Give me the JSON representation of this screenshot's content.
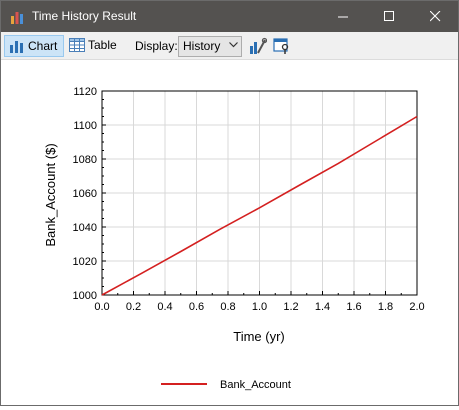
{
  "window": {
    "title": "Time History Result",
    "minimize_icon": "minimize-icon",
    "maximize_icon": "maximize-icon",
    "close_icon": "close-icon"
  },
  "toolbar": {
    "chart_label": "Chart",
    "table_label": "Table",
    "display_label": "Display:",
    "display_value": "History",
    "active_view": "Chart"
  },
  "colors": {
    "series": "#d42020",
    "grid": "#d9d9d9",
    "active_button_bg": "#cce4f7",
    "titlebar": "#545250"
  },
  "chart_data": {
    "type": "line",
    "xlabel": "Time (yr)",
    "ylabel": "Bank_Account ($)",
    "xlim": [
      0,
      2
    ],
    "ylim": [
      1000,
      1120
    ],
    "xticks": [
      "0.0",
      "0.2",
      "0.4",
      "0.6",
      "0.8",
      "1.0",
      "1.2",
      "1.4",
      "1.6",
      "1.8",
      "2.0"
    ],
    "yticks": [
      "1000",
      "1020",
      "1040",
      "1060",
      "1080",
      "1100",
      "1120"
    ],
    "grid": true,
    "legend_position": "bottom-center",
    "series": [
      {
        "name": "Bank_Account",
        "color": "#d42020",
        "x": [
          0,
          0.25,
          0.5,
          0.75,
          1.0,
          1.25,
          1.5,
          1.75,
          2.0
        ],
        "y": [
          1000,
          1012.7,
          1025.6,
          1038.7,
          1051.3,
          1064.4,
          1077.4,
          1091.2,
          1105.0
        ]
      }
    ]
  }
}
